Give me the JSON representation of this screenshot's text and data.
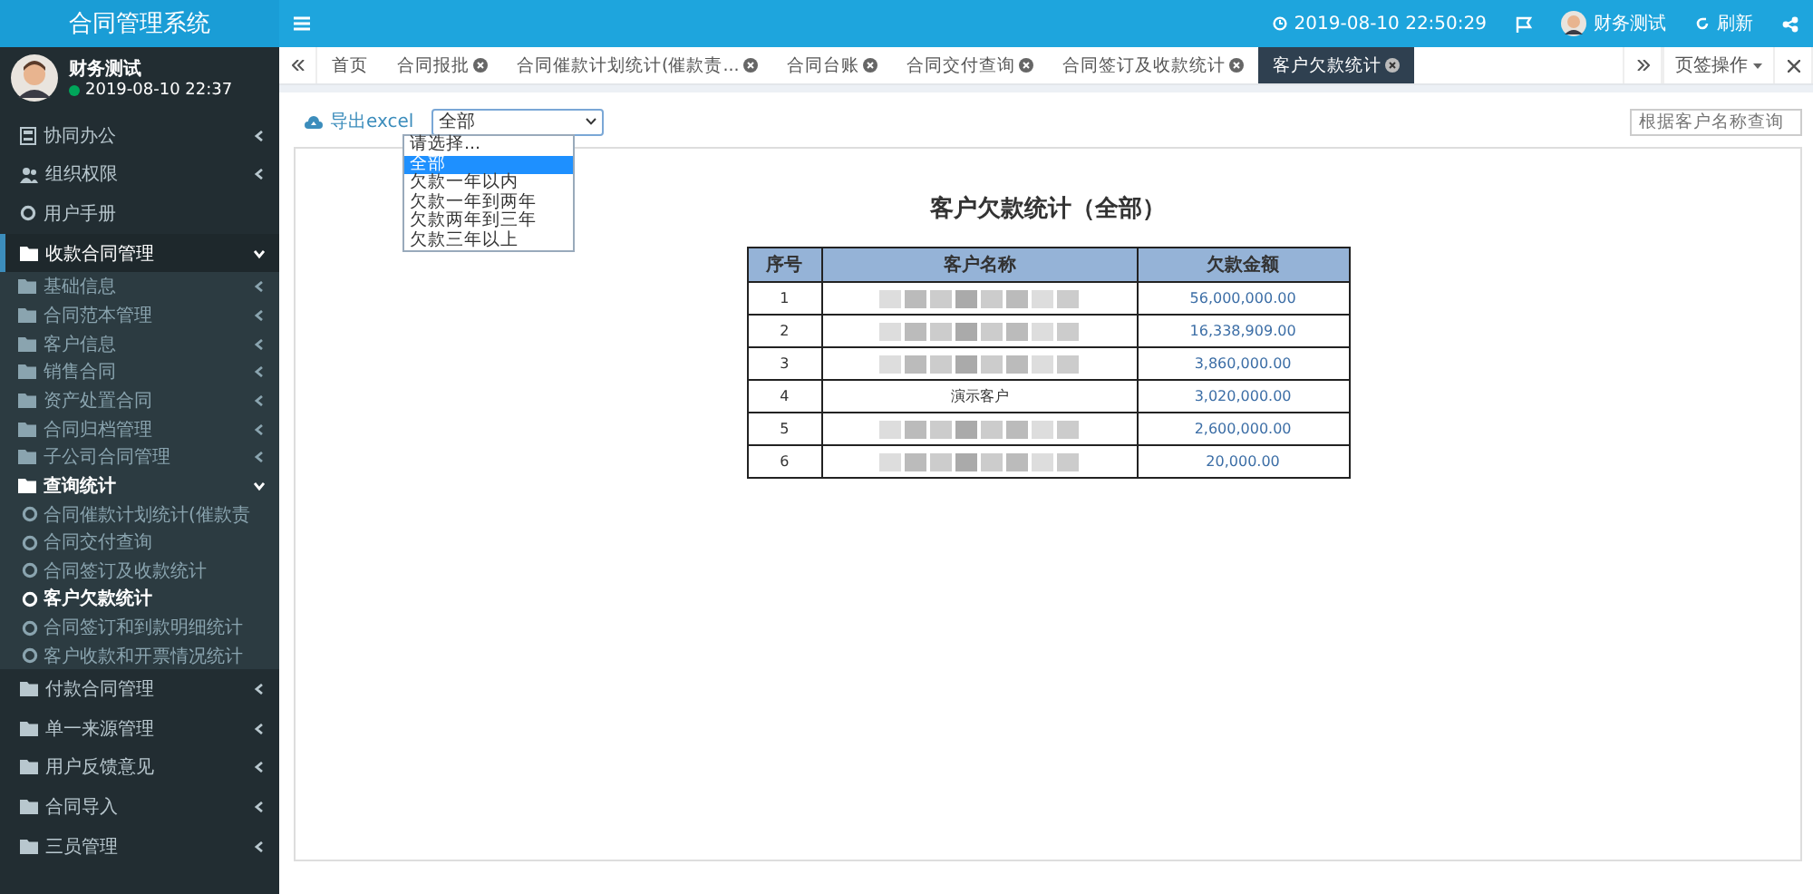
{
  "app_title": "合同管理系统",
  "user": {
    "name": "财务测试",
    "login_time": "2019-08-10 22:37",
    "online": true
  },
  "sidebar": {
    "items": [
      {
        "label": "协同办公",
        "kind": "doc",
        "expanded": false,
        "selected": false
      },
      {
        "label": "组织权限",
        "kind": "users",
        "expanded": false,
        "selected": false
      },
      {
        "label": "用户手册",
        "kind": "circle",
        "selected": false
      },
      {
        "label": "收款合同管理",
        "kind": "folder",
        "expanded": true,
        "selected": true,
        "children": [
          {
            "label": "基础信息",
            "kind": "folder",
            "expanded": false,
            "selected": false
          },
          {
            "label": "合同范本管理",
            "kind": "folder",
            "expanded": false,
            "selected": false
          },
          {
            "label": "客户信息",
            "kind": "folder",
            "expanded": false,
            "selected": false
          },
          {
            "label": "销售合同",
            "kind": "folder",
            "expanded": false,
            "selected": false
          },
          {
            "label": "资产处置合同",
            "kind": "folder",
            "expanded": false,
            "selected": false
          },
          {
            "label": "合同归档管理",
            "kind": "folder",
            "expanded": false,
            "selected": false
          },
          {
            "label": "子公司合同管理",
            "kind": "folder",
            "expanded": false,
            "selected": false
          },
          {
            "label": "查询统计",
            "kind": "folder",
            "expanded": true,
            "selected": true,
            "children": [
              {
                "label": "合同催款计划统计(催款责",
                "kind": "circle",
                "selected": false
              },
              {
                "label": "合同交付查询",
                "kind": "circle",
                "selected": false
              },
              {
                "label": "合同签订及收款统计",
                "kind": "circle",
                "selected": false
              },
              {
                "label": "客户欠款统计",
                "kind": "circle",
                "selected": true
              },
              {
                "label": "合同签订和到款明细统计",
                "kind": "circle",
                "selected": false
              },
              {
                "label": "客户收款和开票情况统计",
                "kind": "circle",
                "selected": false
              }
            ]
          }
        ]
      },
      {
        "label": "付款合同管理",
        "kind": "folder",
        "expanded": false,
        "selected": false
      },
      {
        "label": "单一来源管理",
        "kind": "folder",
        "expanded": false,
        "selected": false
      },
      {
        "label": "用户反馈意见",
        "kind": "folder",
        "expanded": false,
        "selected": false
      },
      {
        "label": "合同导入",
        "kind": "folder",
        "expanded": false,
        "selected": false
      },
      {
        "label": "三员管理",
        "kind": "folder",
        "expanded": false,
        "selected": false
      }
    ]
  },
  "header": {
    "datetime": "2019-08-10 22:50:29",
    "user_name": "财务测试",
    "refresh": "刷新"
  },
  "tabs": [
    {
      "label": "首页",
      "closable": false,
      "selected": false
    },
    {
      "label": "合同报批",
      "closable": true,
      "selected": false
    },
    {
      "label": "合同催款计划统计(催款责...",
      "closable": true,
      "selected": false
    },
    {
      "label": "合同台账",
      "closable": true,
      "selected": false
    },
    {
      "label": "合同交付查询",
      "closable": true,
      "selected": false
    },
    {
      "label": "合同签订及收款统计",
      "closable": true,
      "selected": false
    },
    {
      "label": "客户欠款统计",
      "closable": true,
      "selected": true
    }
  ],
  "tab_actions": "页签操作",
  "toolbar": {
    "export": "导出excel",
    "filter_value": "全部",
    "dropdown_open": true,
    "options": [
      {
        "label": "请选择...",
        "selected": false
      },
      {
        "label": "全部",
        "selected": true
      },
      {
        "label": "欠款一年以内",
        "selected": false
      },
      {
        "label": "欠款一年到两年",
        "selected": false
      },
      {
        "label": "欠款两年到三年",
        "selected": false
      },
      {
        "label": "欠款三年以上",
        "selected": false
      }
    ],
    "search": {
      "placeholder": "根据客户名称查询"
    }
  },
  "report": {
    "title": "客户欠款统计（全部）",
    "columns": [
      "序号",
      "客户名称",
      "欠款金额"
    ],
    "rows": [
      {
        "no": "1",
        "redacted": true,
        "amount": "56,000,000.00"
      },
      {
        "no": "2",
        "redacted": true,
        "amount": "16,338,909.00"
      },
      {
        "no": "3",
        "redacted": true,
        "amount": "3,860,000.00"
      },
      {
        "no": "4",
        "customer": "演示客户",
        "redacted": false,
        "amount": "3,020,000.00"
      },
      {
        "no": "5",
        "redacted": true,
        "amount": "2,600,000.00"
      },
      {
        "no": "6",
        "redacted": true,
        "amount": "20,000.00"
      }
    ]
  }
}
